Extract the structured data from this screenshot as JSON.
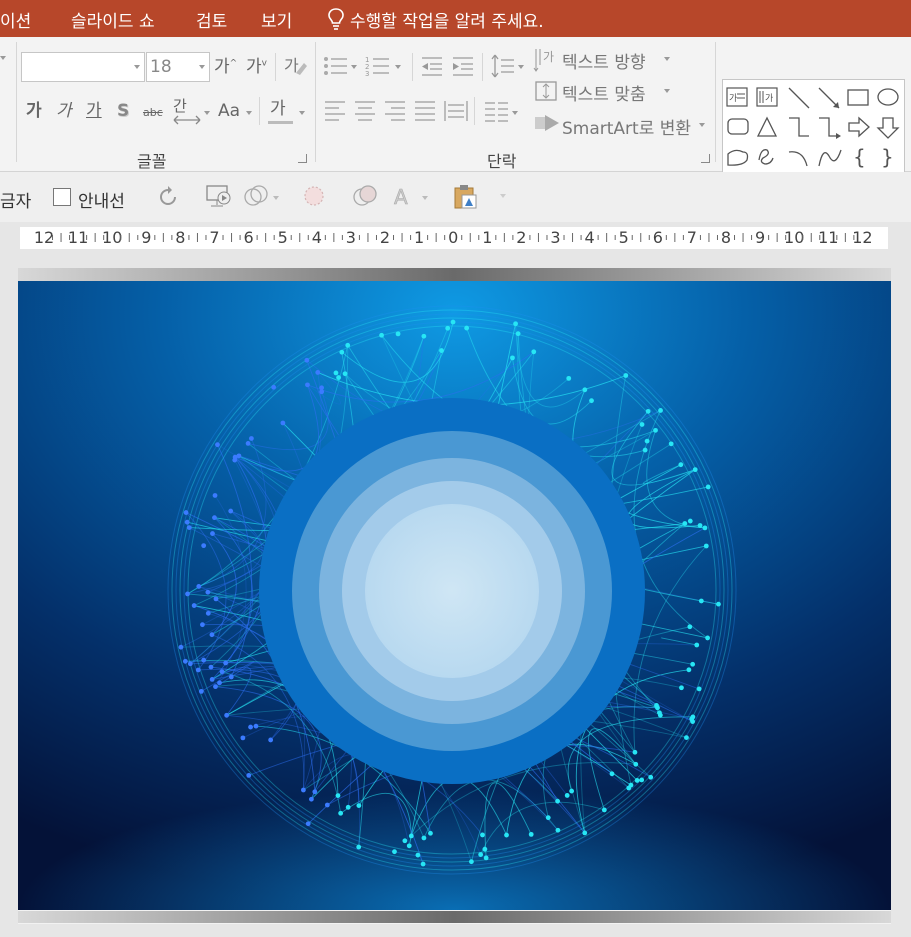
{
  "menu": {
    "tabs": [
      "이션",
      "슬라이드 쇼",
      "검토",
      "보기"
    ],
    "tell_me": "수행할 작업을 알려 주세요."
  },
  "font_group": {
    "label": "글꼴",
    "font_name_value": "",
    "font_size_placeholder": "18",
    "grow_label": "가",
    "shrink_label": "가",
    "bold_label": "가",
    "italic_label": "가",
    "underline_label": "가",
    "shadow_label": "S",
    "strike_label": "abc",
    "spacing_label": "간",
    "case_label": "Aa",
    "color_label": "가"
  },
  "paragraph_group": {
    "label": "단락",
    "text_direction": "텍스트 방향",
    "align_text": "텍스트 맞춤",
    "smartart": "SmartArt로 변환"
  },
  "qat": {
    "partial_label": "금자",
    "guides_label": "안내선",
    "guides_checked": false
  },
  "ruler": {
    "labels": [
      "12",
      "11",
      "10",
      "9",
      "8",
      "7",
      "6",
      "5",
      "4",
      "3",
      "2",
      "1",
      "0",
      "1",
      "2",
      "3",
      "4",
      "5",
      "6",
      "7",
      "8",
      "9",
      "10",
      "11",
      "12"
    ]
  },
  "colors": {
    "ribbon_tab_bg": "#b7472a",
    "slide_bg_center": "#0a7cc8",
    "slide_bg_edge": "#041238",
    "ring_outer": "#0a6fc4",
    "ring_inner": "#c4e0f2",
    "network": "#27e6f5"
  }
}
